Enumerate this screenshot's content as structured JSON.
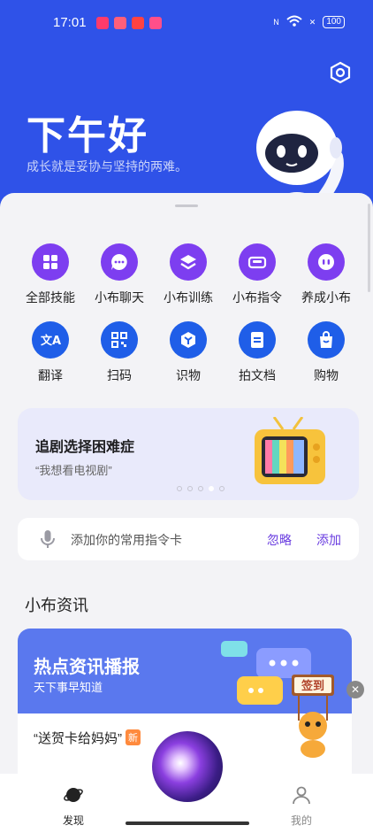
{
  "status": {
    "time": "17:01",
    "right_logo": "LOGO\nTNO",
    "battery": "100"
  },
  "header": {
    "greeting": "下午好",
    "subtitle": "成长就是妥协与坚持的两难。"
  },
  "skills_row1": [
    {
      "label": "全部技能",
      "icon": "grid-icon"
    },
    {
      "label": "小布聊天",
      "icon": "chat-icon"
    },
    {
      "label": "小布训练",
      "icon": "layers-icon"
    },
    {
      "label": "小布指令",
      "icon": "bed-icon"
    },
    {
      "label": "养成小布",
      "icon": "face-icon"
    }
  ],
  "skills_row2": [
    {
      "label": "翻译",
      "icon": "translate-icon"
    },
    {
      "label": "扫码",
      "icon": "qr-icon"
    },
    {
      "label": "识物",
      "icon": "lens-icon"
    },
    {
      "label": "拍文档",
      "icon": "document-icon"
    },
    {
      "label": "购物",
      "icon": "bag-icon"
    }
  ],
  "banner": {
    "title": "追剧选择困难症",
    "subtitle": "“我想看电视剧”"
  },
  "command_card": {
    "placeholder": "添加你的常用指令卡",
    "ignore": "忽略",
    "add": "添加"
  },
  "news": {
    "section_title": "小布资讯",
    "header_title": "热点资讯播报",
    "header_sub": "天下事早知道",
    "item": "“送贺卡给妈妈”",
    "item_badge": "新"
  },
  "signin": {
    "label": "签到"
  },
  "nav": {
    "discover": "发现",
    "mine": "我的"
  },
  "colors": {
    "header_bg": "#2f52e8",
    "accent_purple": "#7d3ef0",
    "accent_blue": "#1f5ee8",
    "link_purple": "#6a3de0"
  }
}
